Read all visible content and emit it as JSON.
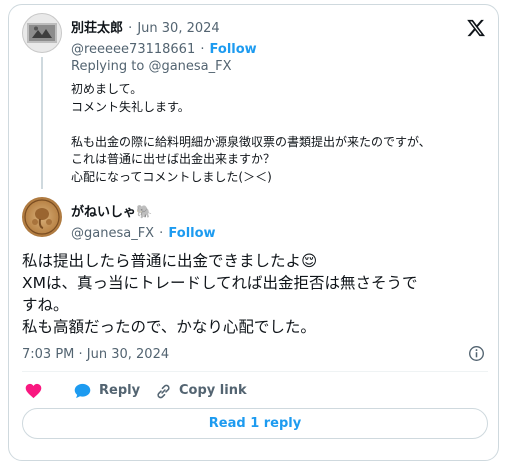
{
  "parent_tweet": {
    "display_name": "別荘太郎",
    "separator": "·",
    "date": "Jun 30, 2024",
    "handle": "@reeeee73118661",
    "follow_separator": "·",
    "follow_label": "Follow",
    "replying_prefix": "Replying to",
    "replying_handle": "@ganesa_FX",
    "lines": [
      "初めまして。",
      "コメント失礼します。",
      "",
      "私も出金の際に給料明細か源泉徴収票の書類提出が来たのですが、",
      "これは普通に出せば出金出来ますか？",
      "心配になってコメントしました(＞＜)"
    ]
  },
  "main_tweet": {
    "display_name": "がねいしゃ🐘",
    "handle": "@ganesa_FX",
    "follow_separator": "·",
    "follow_label": "Follow",
    "lines": [
      "私は提出したら普通に出金できましたよ😌",
      "XMは、真っ当にトレードしてれば出金拒否は無さそうで",
      "すね。",
      "私も高額だったので、かなり心配でした。"
    ],
    "timestamp": "7:03 PM · Jun 30, 2024"
  },
  "actions": {
    "reply_label": "Reply",
    "copy_link_label": "Copy link"
  },
  "read_reply_label": "Read 1 reply",
  "icons": [
    "x-logo-icon",
    "heart-icon",
    "reply-bubble-icon",
    "link-icon",
    "info-icon"
  ],
  "colors": {
    "accent": "#1d9bf0",
    "heart": "#f91880",
    "text": "#0f1419",
    "muted": "#536471",
    "border": "#cfd9de"
  }
}
